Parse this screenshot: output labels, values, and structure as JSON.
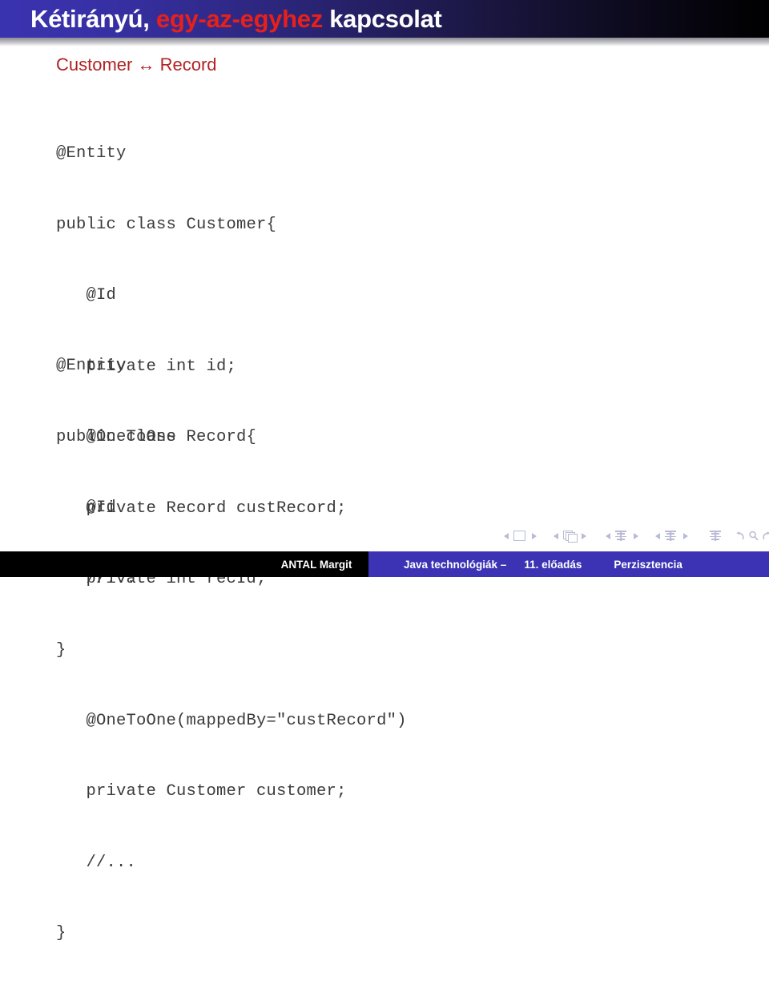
{
  "slide": {
    "title_parts": [
      {
        "text": "Kétirányú, ",
        "highlight": false
      },
      {
        "text": "egy-az-egyhez",
        "highlight": true
      },
      {
        "text": " kapcsolat",
        "highlight": false
      }
    ],
    "title_plain": "Kétirányú, egy-az-egyhez kapcsolat",
    "subtitle": "Customer ↔ Record",
    "code_blocks": [
      {
        "id": "customer-entity",
        "lines": [
          "@Entity",
          "public class Customer{",
          "   @Id",
          "   private int id;",
          "   @OneToOne",
          "   private Record custRecord;",
          "   //...",
          "}"
        ]
      },
      {
        "id": "record-entity",
        "lines": [
          "@Entity",
          "public class Record{",
          "   @Id",
          "   private int recId;",
          "",
          "   @OneToOne(mappedBy=\"custRecord\")",
          "   private Customer customer;",
          "   //...",
          "}"
        ]
      }
    ]
  },
  "navigation": {
    "groups": [
      {
        "name": "slide",
        "icon": "slide-icon",
        "prev": "◀",
        "next": "▶"
      },
      {
        "name": "frame",
        "icon": "frame-icon",
        "prev": "◀",
        "next": "▶"
      },
      {
        "name": "subsection",
        "icon": "subsection-icon",
        "prev": "◀",
        "next": "▶"
      },
      {
        "name": "section",
        "icon": "section-icon",
        "prev": "◀",
        "next": "▶"
      }
    ],
    "doc_icon": "document-icon",
    "back_icon": "back-icon",
    "search_icon": "search-icon",
    "forward_icon": "forward-icon"
  },
  "footer": {
    "author": "ANTAL Margit",
    "course": "Java technológiák –",
    "lecture": "11. előadás",
    "section": "Perzisztencia"
  },
  "colors": {
    "title_bar_left": "#3a33b0",
    "title_bar_right": "#000000",
    "title_highlight": "#e8201a",
    "subtitle": "#b32222",
    "code_text": "#3b3b3b",
    "footer_blue": "#3b33b3",
    "footer_black": "#000000",
    "nav_icon": "#b9bad6"
  }
}
